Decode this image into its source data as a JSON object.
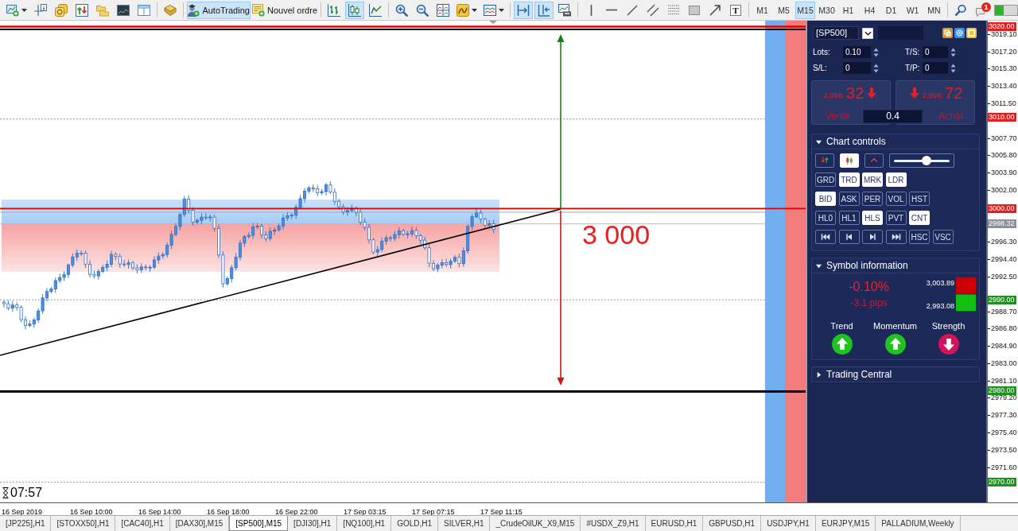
{
  "toolbar": {
    "groups": [
      [
        {
          "kind": "new-chart",
          "selected": false,
          "dropdown": true
        },
        {
          "kind": "data-window",
          "selected": false,
          "dropdown": false
        },
        {
          "kind": "market-watch",
          "selected": false,
          "dropdown": false
        },
        {
          "kind": "navigator",
          "selected": false,
          "dropdown": false
        },
        {
          "kind": "profiles",
          "selected": false,
          "dropdown": false
        },
        {
          "kind": "chart-window",
          "selected": false,
          "dropdown": false
        },
        {
          "kind": "layout",
          "selected": false,
          "dropdown": false
        }
      ],
      [
        {
          "kind": "strategy-tester",
          "selected": false,
          "dropdown": false
        }
      ],
      [
        {
          "kind": "auto-trading",
          "label": "AutoTrading",
          "selected": true,
          "dropdown": false
        },
        {
          "kind": "new-order",
          "label": "Nouvel ordre",
          "selected": false,
          "dropdown": false
        }
      ],
      [
        {
          "kind": "bar-chart",
          "selected": false,
          "dropdown": false
        },
        {
          "kind": "candlestick-chart",
          "selected": true,
          "dropdown": false
        },
        {
          "kind": "line-chart",
          "selected": false,
          "dropdown": false
        }
      ],
      [
        {
          "kind": "zoom-in",
          "selected": false,
          "dropdown": false
        },
        {
          "kind": "zoom-out",
          "selected": false,
          "dropdown": false
        },
        {
          "kind": "tile-windows",
          "selected": false,
          "dropdown": false
        },
        {
          "kind": "indicators",
          "selected": false,
          "dropdown": true
        },
        {
          "kind": "templates",
          "selected": false,
          "dropdown": true
        }
      ],
      [
        {
          "kind": "chart-shift",
          "selected": true,
          "dropdown": false
        },
        {
          "kind": "auto-scroll",
          "selected": true,
          "dropdown": false
        },
        {
          "kind": "chart-save",
          "selected": false,
          "dropdown": false
        }
      ],
      [
        {
          "kind": "vertical-line",
          "selected": false,
          "dropdown": false
        },
        {
          "kind": "horizontal-line",
          "selected": false,
          "dropdown": false
        },
        {
          "kind": "trend-line",
          "selected": false,
          "dropdown": false
        },
        {
          "kind": "channel",
          "selected": false,
          "dropdown": false
        },
        {
          "kind": "fibonacci",
          "selected": false,
          "dropdown": false
        },
        {
          "kind": "rectangle",
          "selected": false,
          "dropdown": false
        },
        {
          "kind": "arrow",
          "selected": false,
          "dropdown": false
        },
        {
          "kind": "text-tool",
          "label": "T",
          "selected": false,
          "dropdown": false
        }
      ]
    ],
    "timeframes": [
      {
        "label": "M1",
        "selected": false
      },
      {
        "label": "M5",
        "selected": false
      },
      {
        "label": "M15",
        "selected": true
      },
      {
        "label": "M30",
        "selected": false
      },
      {
        "label": "H1",
        "selected": false
      },
      {
        "label": "H4",
        "selected": false
      },
      {
        "label": "D1",
        "selected": false
      },
      {
        "label": "W1",
        "selected": false
      },
      {
        "label": "MN",
        "selected": false
      }
    ],
    "notification_count": "1"
  },
  "chart": {
    "annotation": "3 000",
    "countdown": "07:57",
    "price_axis": [
      {
        "label": "3020.00",
        "color": "#e11d1d"
      },
      {
        "label": "3019.10"
      },
      {
        "label": "3017.20"
      },
      {
        "label": "3015.30"
      },
      {
        "label": "3013.40"
      },
      {
        "label": "3011.50"
      },
      {
        "label": "3010.00",
        "color": "#e11d1d"
      },
      {
        "label": "3007.70"
      },
      {
        "label": "3005.80"
      },
      {
        "label": "3003.90"
      },
      {
        "label": "3002.00"
      },
      {
        "label": "3000.00",
        "color": "#e11d1d"
      },
      {
        "label": "2998.32",
        "color": "#8a8f99"
      },
      {
        "label": "2996.30"
      },
      {
        "label": "2994.40"
      },
      {
        "label": "2992.50"
      },
      {
        "label": "2990.00",
        "color": "#1e921e"
      },
      {
        "label": "2988.70"
      },
      {
        "label": "2986.80"
      },
      {
        "label": "2984.90"
      },
      {
        "label": "2983.00"
      },
      {
        "label": "2981.10"
      },
      {
        "label": "2980.00",
        "color": "#1e921e"
      },
      {
        "label": "2979.20"
      },
      {
        "label": "2977.30"
      },
      {
        "label": "2975.40"
      },
      {
        "label": "2973.50"
      },
      {
        "label": "2971.60"
      },
      {
        "label": "2970.00",
        "color": "#1e921e"
      }
    ],
    "time_axis": [
      "16 Sep 2019",
      "16 Sep 10:00",
      "16 Sep 14:00",
      "16 Sep 18:00",
      "16 Sep 22:00",
      "17 Sep 03:15",
      "17 Sep 07:15",
      "17 Sep 11:15"
    ]
  },
  "trade_panel": {
    "symbol": "[SP500]",
    "fields": [
      {
        "label": "Lots:",
        "value": "0.10"
      },
      {
        "label": "T/S:",
        "value": "0"
      },
      {
        "label": "S/L:",
        "value": "0"
      },
      {
        "label": "T/P:",
        "value": "0"
      }
    ],
    "sell": {
      "price": "2,998.",
      "pips": "32",
      "label": "Vente",
      "rising": false
    },
    "buy": {
      "price": "2,998.",
      "pips": "72",
      "label": "Achat",
      "rising": false
    },
    "spread": "0.4",
    "chart_controls": {
      "title": "Chart controls",
      "expanded": true,
      "rows": [
        [
          {
            "kind": "bar-colors",
            "selected": false
          },
          {
            "kind": "candles",
            "selected": true
          },
          {
            "kind": "peak",
            "selected": false
          },
          {
            "kind": "slider",
            "level": 0.58
          }
        ],
        [
          {
            "kind": "text",
            "label": "GRD",
            "selected": false
          },
          {
            "kind": "text",
            "label": "TRD",
            "selected": true
          },
          {
            "kind": "text",
            "label": "MRK",
            "selected": true
          },
          {
            "kind": "text",
            "label": "LDR",
            "selected": true
          }
        ],
        [
          {
            "kind": "text",
            "label": "BID",
            "selected": true
          },
          {
            "kind": "text",
            "label": "ASK",
            "selected": false
          },
          {
            "kind": "text",
            "label": "PER",
            "selected": false
          },
          {
            "kind": "text",
            "label": "VOL",
            "selected": false
          },
          {
            "kind": "text",
            "label": "HST",
            "selected": false
          }
        ],
        [
          {
            "kind": "text",
            "label": "HL0",
            "selected": false
          },
          {
            "kind": "text",
            "label": "HL1",
            "selected": false
          },
          {
            "kind": "text",
            "label": "HLS",
            "selected": true
          },
          {
            "kind": "text",
            "label": "PVT",
            "selected": false
          },
          {
            "kind": "text",
            "label": "CNT",
            "selected": true
          }
        ],
        [
          {
            "kind": "first",
            "selected": false
          },
          {
            "kind": "previous",
            "selected": false
          },
          {
            "kind": "next",
            "selected": false
          },
          {
            "kind": "last",
            "selected": false
          },
          {
            "kind": "text",
            "label": "HSC",
            "selected": false
          },
          {
            "kind": "text",
            "label": "VSC",
            "selected": false
          }
        ]
      ]
    },
    "symbol_information": {
      "title": "Symbol information",
      "expanded": true,
      "change": "-0.10%",
      "pips": "-3.1 pips",
      "high": "3,003.89",
      "low": "2,993.08",
      "signals": [
        {
          "label": "Trend",
          "rising": true
        },
        {
          "label": "Momentum",
          "rising": true
        },
        {
          "label": "Strength",
          "rising": false
        }
      ]
    },
    "trading_central": {
      "title": "Trading Central",
      "expanded": false
    }
  },
  "symbol_tabs": [
    {
      "label": "[JP225],H1",
      "selected": false
    },
    {
      "label": "[STOXX50],H1",
      "selected": false
    },
    {
      "label": "[CAC40],H1",
      "selected": false
    },
    {
      "label": "[DAX30],M15",
      "selected": false
    },
    {
      "label": "[SP500],M15",
      "selected": true
    },
    {
      "label": "[DJI30],H1",
      "selected": false
    },
    {
      "label": "[NQ100],H1",
      "selected": false
    },
    {
      "label": "GOLD,H1",
      "selected": false
    },
    {
      "label": "SILVER,H1",
      "selected": false
    },
    {
      "label": "_CrudeOilUK_X9,M15",
      "selected": false
    },
    {
      "label": "#USDX_Z9,H1",
      "selected": false
    },
    {
      "label": "EURUSD,H1",
      "selected": false
    },
    {
      "label": "GBPUSD,H1",
      "selected": false
    },
    {
      "label": "USDJPY,H1",
      "selected": false
    },
    {
      "label": "EURJPY,M15",
      "selected": false
    },
    {
      "label": "PALLADIUM,Weekly",
      "selected": false
    }
  ]
}
